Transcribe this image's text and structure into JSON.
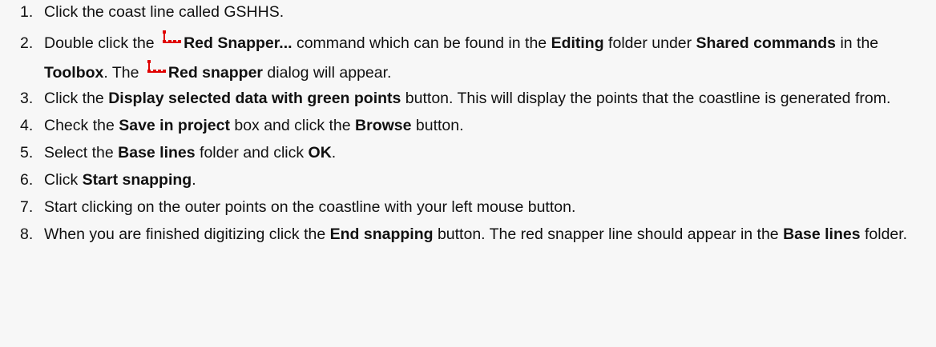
{
  "steps": [
    {
      "number": "1.",
      "segments": [
        {
          "text": "Click the coast line called GSHHS."
        }
      ]
    },
    {
      "number": "2.",
      "segments": [
        {
          "text": "Double click the "
        },
        {
          "icon": "red-snapper-icon"
        },
        {
          "text": "Red Snapper...",
          "bold": true
        },
        {
          "text": " command which can be found in the "
        },
        {
          "text": "Editing",
          "bold": true
        },
        {
          "text": " folder under "
        },
        {
          "text": "Shared commands",
          "bold": true
        },
        {
          "text": " in the "
        },
        {
          "text": "Toolbox",
          "bold": true
        },
        {
          "text": ".  The "
        },
        {
          "icon": "red-snapper-icon"
        },
        {
          "text": "Red snapper",
          "bold": true
        },
        {
          "text": " dialog will appear."
        }
      ]
    },
    {
      "number": "3.",
      "segments": [
        {
          "text": "Click the "
        },
        {
          "text": "Display selected data with green points",
          "bold": true
        },
        {
          "text": " button.  This will display the points that the coastline is generated from."
        }
      ]
    },
    {
      "number": "4.",
      "segments": [
        {
          "text": "Check the "
        },
        {
          "text": "Save in project",
          "bold": true
        },
        {
          "text": " box and click the "
        },
        {
          "text": "Browse",
          "bold": true
        },
        {
          "text": " button."
        }
      ]
    },
    {
      "number": "5.",
      "segments": [
        {
          "text": "Select the "
        },
        {
          "text": "Base lines",
          "bold": true
        },
        {
          "text": " folder and click "
        },
        {
          "text": "OK",
          "bold": true
        },
        {
          "text": "."
        }
      ]
    },
    {
      "number": "6.",
      "segments": [
        {
          "text": "Click "
        },
        {
          "text": "Start snapping",
          "bold": true
        },
        {
          "text": "."
        }
      ]
    },
    {
      "number": "7.",
      "segments": [
        {
          "text": "Start clicking on the outer points on the coastline with your left mouse button."
        }
      ]
    },
    {
      "number": "8.",
      "segments": [
        {
          "text": "When you are finished digitizing click the "
        },
        {
          "text": "End snapping",
          "bold": true
        },
        {
          "text": " button.  The red snapper line should appear in the "
        },
        {
          "text": "Base lines",
          "bold": true
        },
        {
          "text": " folder."
        }
      ]
    }
  ],
  "colors": {
    "background": "#f7f7f7",
    "text": "#111111",
    "icon_red": "#e00000"
  }
}
